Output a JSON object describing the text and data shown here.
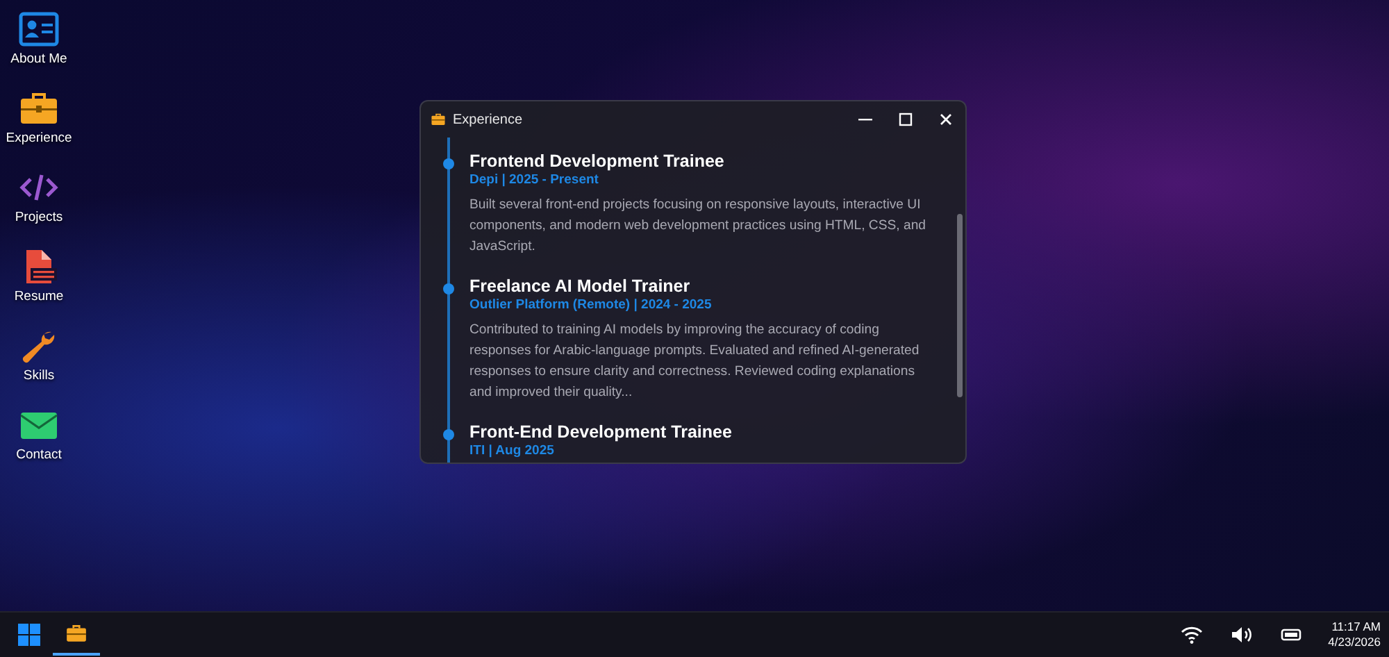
{
  "desktop_icons": [
    {
      "label": "About Me",
      "kind": "contact-card"
    },
    {
      "label": "Experience",
      "kind": "briefcase"
    },
    {
      "label": "Projects",
      "kind": "code"
    },
    {
      "label": "Resume",
      "kind": "pdf"
    },
    {
      "label": "Skills",
      "kind": "wrench"
    },
    {
      "label": "Contact",
      "kind": "envelope"
    }
  ],
  "window": {
    "title": "Experience",
    "entries": [
      {
        "title": "Frontend Development Trainee",
        "meta": "Depi | 2025 - Present",
        "description": "Built several front-end projects focusing on responsive layouts, interactive UI components, and modern web development practices using HTML, CSS, and JavaScript."
      },
      {
        "title": "Freelance AI Model Trainer",
        "meta": "Outlier Platform (Remote) | 2024 - 2025",
        "description": "Contributed to training AI models by improving the accuracy of coding responses for Arabic-language prompts. Evaluated and refined AI-generated responses to ensure clarity and correctness. Reviewed coding explanations and improved their quality..."
      },
      {
        "title": "Front-End Development Trainee",
        "meta": "ITI | Aug 2025"
      }
    ]
  },
  "taskbar": {
    "apps": [
      {
        "kind": "briefcase",
        "selected": true
      }
    ],
    "time": "11:17 AM",
    "date": "4/23/2026"
  }
}
